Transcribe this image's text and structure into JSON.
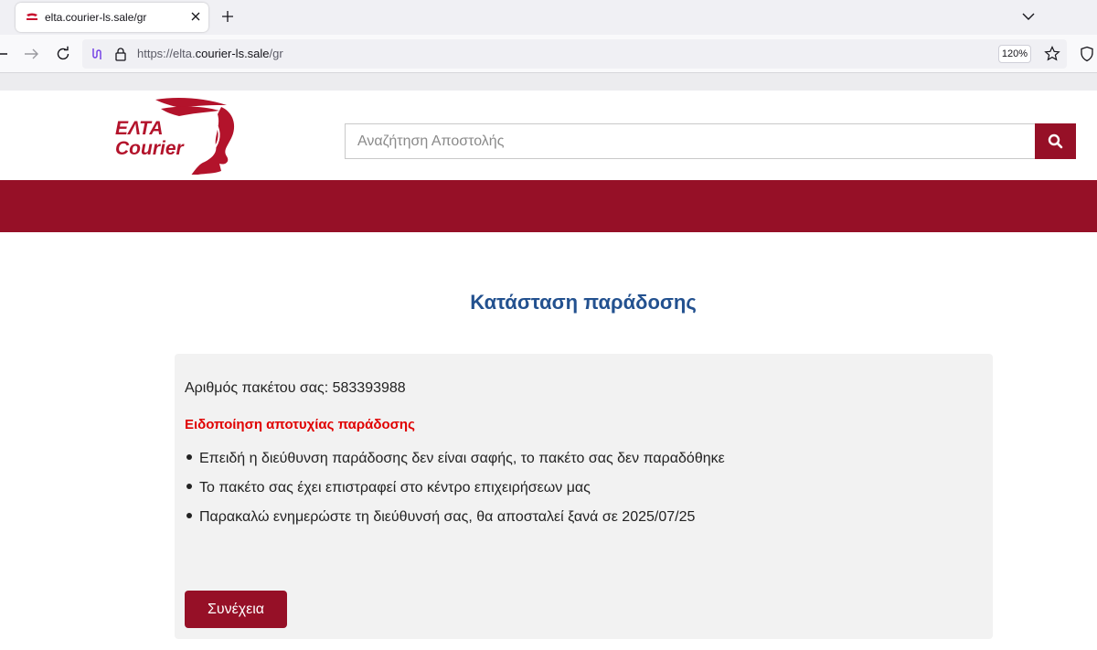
{
  "browser": {
    "tab_title": "elta.courier-ls.sale/gr",
    "url_scheme": "https://",
    "url_sub": "elta.",
    "url_host": "courier-ls.sale",
    "url_path": "/gr",
    "zoom": "120%"
  },
  "header": {
    "logo_line1": "ΕΛΤΑ",
    "logo_line2": "Courier",
    "search_placeholder": "Αναζήτηση Αποστολής",
    "brand_color": "#961027"
  },
  "main": {
    "title": "Κατάσταση παράδοσης",
    "package_label": "Αριθμός πακέτου σας: ",
    "package_number": "583393988",
    "alert": "Ειδοποίηση αποτυχίας παράδοσης",
    "bullets": [
      "Επειδή η διεύθυνση παράδοσης δεν είναι σαφής, το πακέτο σας δεν παραδόθηκε",
      "Το πακέτο σας έχει επιστραφεί στο κέντρο επιχειρήσεων μας",
      "Παρακαλώ ενημερώστε τη διεύθυνσή σας, θα αποσταλεί ξανά σε 2025/07/25"
    ],
    "continue_label": "Συνέχεια"
  }
}
